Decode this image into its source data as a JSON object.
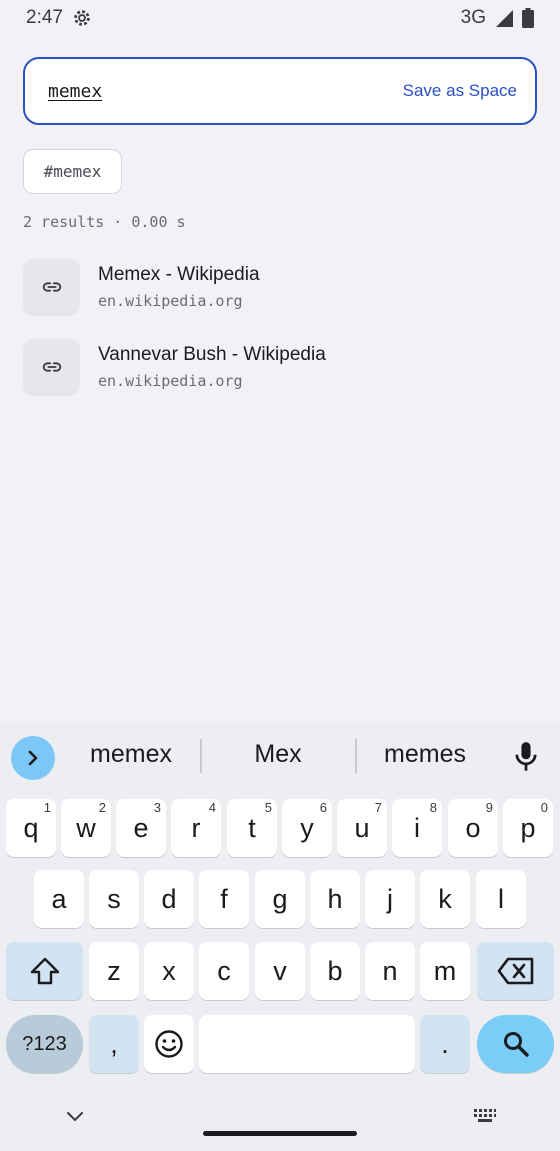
{
  "status_bar": {
    "time": "2:47",
    "network": "3G"
  },
  "search": {
    "query": "memex",
    "save_label": "Save as Space"
  },
  "tag": "#memex",
  "results_meta": "2 results · 0.00 s",
  "results": [
    {
      "title": "Memex - Wikipedia",
      "domain": "en.wikipedia.org",
      "icon": "link-icon"
    },
    {
      "title": "Vannevar Bush - Wikipedia",
      "domain": "en.wikipedia.org",
      "icon": "link-icon"
    }
  ],
  "keyboard": {
    "suggestions": [
      "memex",
      "Mex",
      "memes"
    ],
    "row1": [
      {
        "key": "q",
        "hint": "1"
      },
      {
        "key": "w",
        "hint": "2"
      },
      {
        "key": "e",
        "hint": "3"
      },
      {
        "key": "r",
        "hint": "4"
      },
      {
        "key": "t",
        "hint": "5"
      },
      {
        "key": "y",
        "hint": "6"
      },
      {
        "key": "u",
        "hint": "7"
      },
      {
        "key": "i",
        "hint": "8"
      },
      {
        "key": "o",
        "hint": "9"
      },
      {
        "key": "p",
        "hint": "0"
      }
    ],
    "row2": [
      "a",
      "s",
      "d",
      "f",
      "g",
      "h",
      "j",
      "k",
      "l"
    ],
    "row3": [
      "z",
      "x",
      "c",
      "v",
      "b",
      "n",
      "m"
    ],
    "symbols_label": "?123",
    "comma": ",",
    "period": "."
  },
  "colors": {
    "accent": "#2b4fc4",
    "background": "#f2f2f6",
    "keyboard_accent": "#79cdf7"
  }
}
